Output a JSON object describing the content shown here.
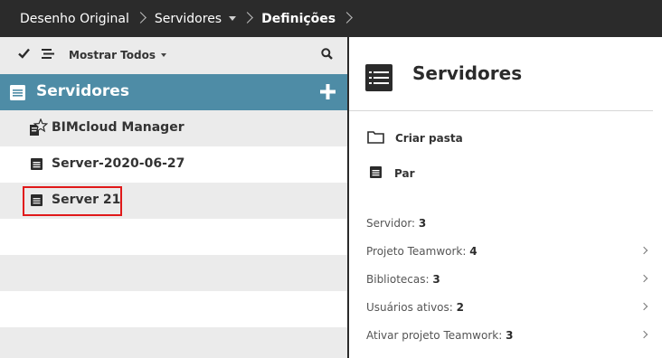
{
  "breadcrumb": {
    "items": [
      {
        "label": "Desenho Original"
      },
      {
        "label": "Servidores"
      },
      {
        "label": "Definições"
      }
    ]
  },
  "toolbar": {
    "show_all_label": "Mostrar Todos"
  },
  "sidebar": {
    "section_title": "Servidores",
    "items": [
      {
        "label": "BIMcloud Manager",
        "icon": "bimcloud-manager-icon"
      },
      {
        "label": "Server-2020-06-27",
        "icon": "server-icon"
      },
      {
        "label": "Server 21",
        "icon": "server-icon",
        "selected": true
      }
    ]
  },
  "details": {
    "title": "Servidores",
    "actions": [
      {
        "label": "Criar pasta",
        "icon": "folder-icon"
      },
      {
        "label": "Par",
        "icon": "server-icon"
      }
    ],
    "stats": [
      {
        "label": "Servidor: ",
        "value": "3"
      },
      {
        "label": "Projeto Teamwork: ",
        "value": "4"
      },
      {
        "label": "Bibliotecas: ",
        "value": "3"
      },
      {
        "label": "Usuários ativos: ",
        "value": "2"
      },
      {
        "label": "Ativar projeto Teamwork: ",
        "value": "3"
      }
    ]
  },
  "colors": {
    "topbar_bg": "#2b2b2b",
    "section_header_bg": "#4e8ca6",
    "row_alt_bg": "#ebebeb",
    "highlight_border": "#e0191a"
  }
}
